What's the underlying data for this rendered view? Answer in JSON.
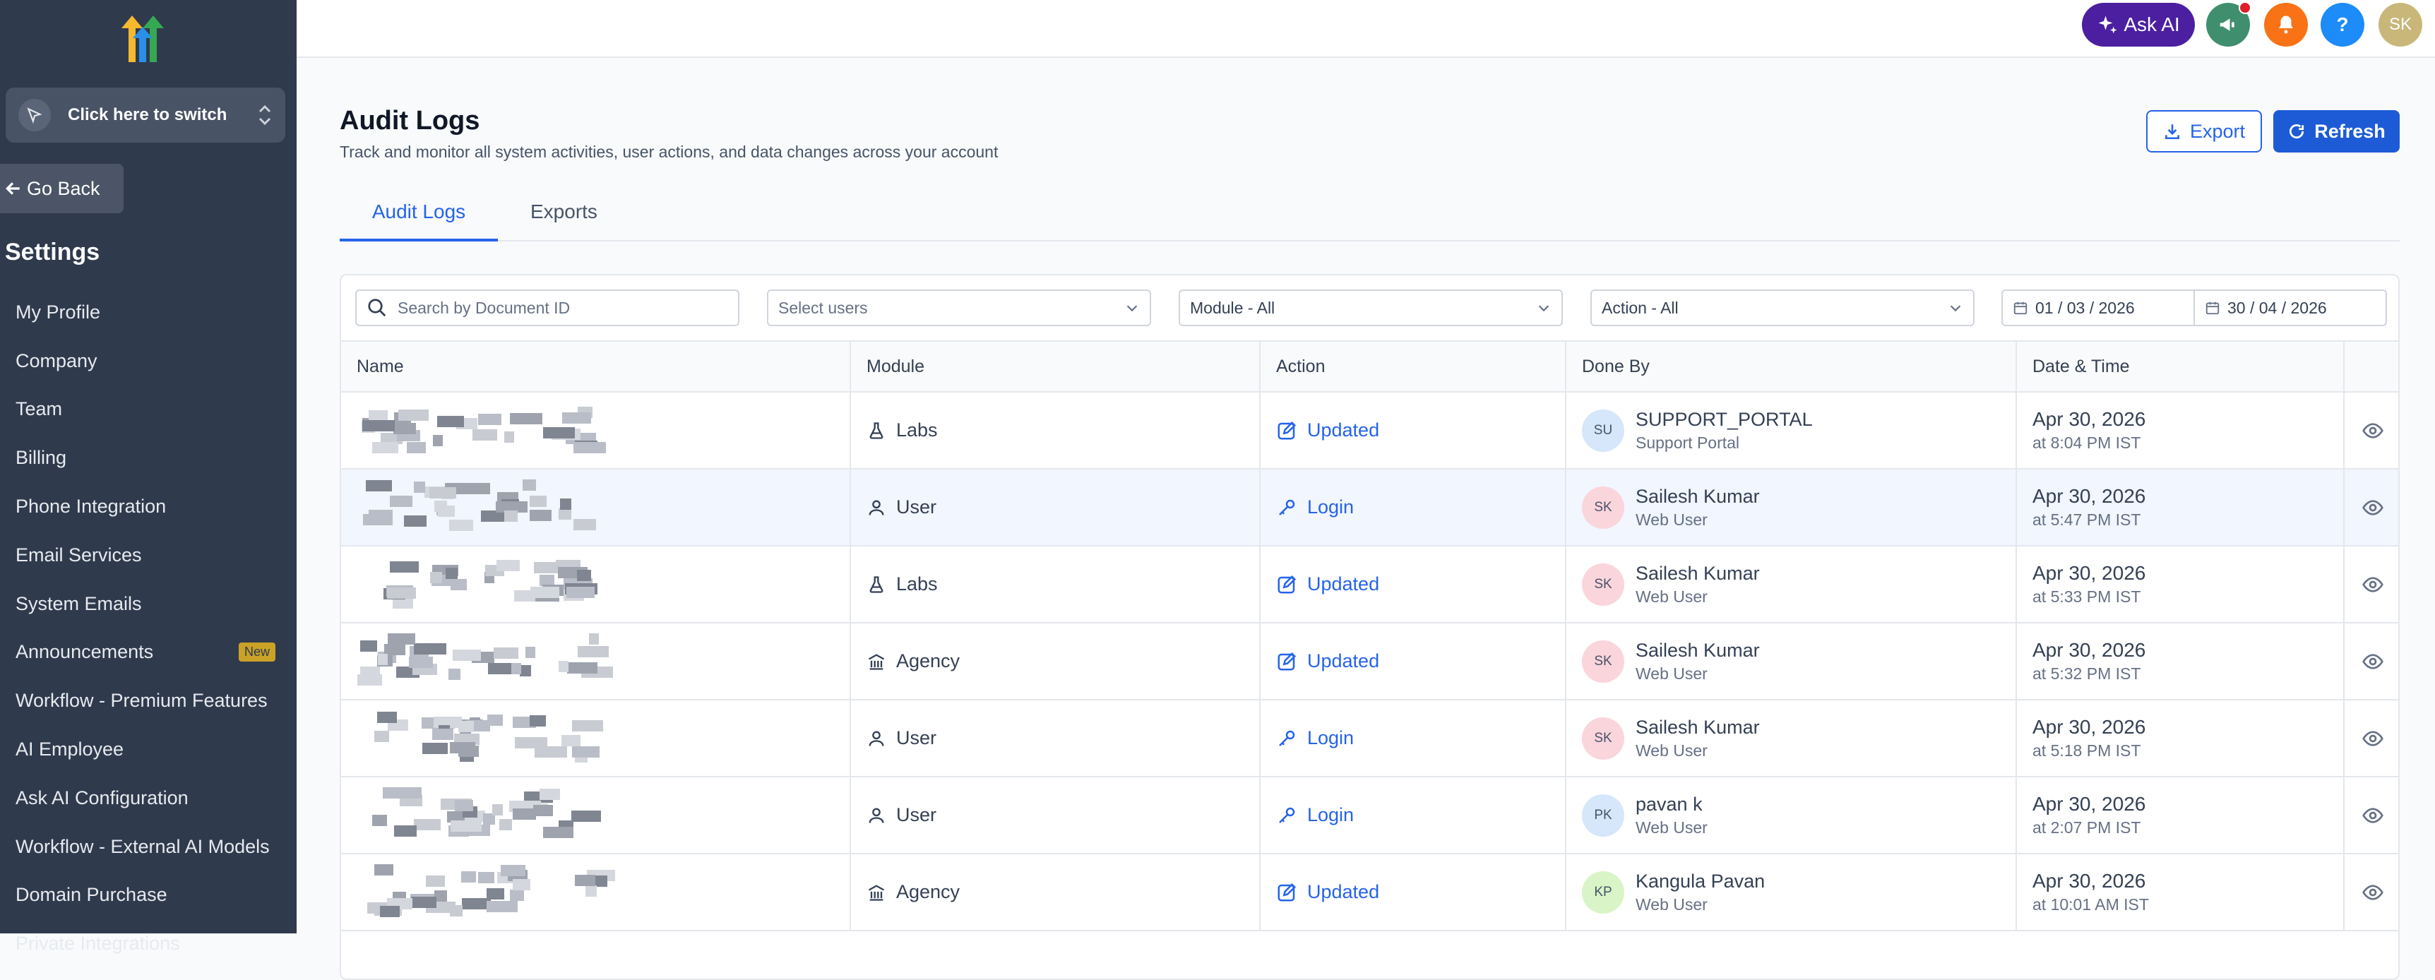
{
  "sidebar": {
    "switcher_label": "Click here to switch",
    "go_back": "Go Back",
    "settings_title": "Settings",
    "items": [
      {
        "label": "My Profile"
      },
      {
        "label": "Company"
      },
      {
        "label": "Team"
      },
      {
        "label": "Billing"
      },
      {
        "label": "Phone Integration"
      },
      {
        "label": "Email Services"
      },
      {
        "label": "System Emails"
      },
      {
        "label": "Announcements",
        "badge": "New"
      },
      {
        "label": "Workflow - Premium Features"
      },
      {
        "label": "AI Employee"
      },
      {
        "label": "Ask AI Configuration"
      },
      {
        "label": "Workflow - External AI Models"
      },
      {
        "label": "Domain Purchase"
      },
      {
        "label": "Private Integrations"
      }
    ]
  },
  "topbar": {
    "ask_ai": "Ask AI",
    "help_icon": "?",
    "avatar": "SK",
    "colors": {
      "ask_ai": "#4b1fa0",
      "announce": "#3f8f6e",
      "bell": "#f97316",
      "help": "#1d8cf8",
      "avatar": "#c9b77a"
    }
  },
  "header": {
    "title": "Audit Logs",
    "subtitle": "Track and monitor all system activities, user actions, and data changes across your account",
    "export": "Export",
    "refresh": "Refresh"
  },
  "tabs": [
    {
      "label": "Audit Logs",
      "active": true
    },
    {
      "label": "Exports",
      "active": false
    }
  ],
  "filters": {
    "search_placeholder": "Search by Document ID",
    "users_placeholder": "Select users",
    "module": "Module - All",
    "action": "Action - All",
    "date_from": "01 / 03 / 2026",
    "date_to": "30 / 04 / 2026"
  },
  "table": {
    "columns": [
      "Name",
      "Module",
      "Action",
      "Done By",
      "Date & Time",
      ""
    ],
    "rows": [
      {
        "module": "Labs",
        "module_icon": "flask-icon",
        "action": "Updated",
        "action_icon": "edit-icon",
        "initials": "SU",
        "avatar_color": "#d6e6fb",
        "by": "SUPPORT_PORTAL",
        "by_sub": "Support Portal",
        "date": "Apr 30, 2026",
        "time": "at 8:04 PM IST"
      },
      {
        "module": "User",
        "module_icon": "user-icon",
        "action": "Login",
        "action_icon": "key-icon",
        "initials": "SK",
        "avatar_color": "#fbd5dc",
        "by": "Sailesh Kumar",
        "by_sub": "Web User",
        "date": "Apr 30, 2026",
        "time": "at 5:47 PM IST"
      },
      {
        "module": "Labs",
        "module_icon": "flask-icon",
        "action": "Updated",
        "action_icon": "edit-icon",
        "initials": "SK",
        "avatar_color": "#fbd5dc",
        "by": "Sailesh Kumar",
        "by_sub": "Web User",
        "date": "Apr 30, 2026",
        "time": "at 5:33 PM IST"
      },
      {
        "module": "Agency",
        "module_icon": "building-icon",
        "action": "Updated",
        "action_icon": "edit-icon",
        "initials": "SK",
        "avatar_color": "#fbd5dc",
        "by": "Sailesh Kumar",
        "by_sub": "Web User",
        "date": "Apr 30, 2026",
        "time": "at 5:32 PM IST"
      },
      {
        "module": "User",
        "module_icon": "user-icon",
        "action": "Login",
        "action_icon": "key-icon",
        "initials": "SK",
        "avatar_color": "#fbd5dc",
        "by": "Sailesh Kumar",
        "by_sub": "Web User",
        "date": "Apr 30, 2026",
        "time": "at 5:18 PM IST"
      },
      {
        "module": "User",
        "module_icon": "user-icon",
        "action": "Login",
        "action_icon": "key-icon",
        "initials": "PK",
        "avatar_color": "#d6e6fb",
        "by": "pavan k",
        "by_sub": "Web User",
        "date": "Apr 30, 2026",
        "time": "at 2:07 PM IST"
      },
      {
        "module": "Agency",
        "module_icon": "building-icon",
        "action": "Updated",
        "action_icon": "edit-icon",
        "initials": "KP",
        "avatar_color": "#d9f5c7",
        "by": "Kangula Pavan",
        "by_sub": "Web User",
        "date": "Apr 30, 2026",
        "time": "at 10:01 AM IST"
      }
    ]
  }
}
